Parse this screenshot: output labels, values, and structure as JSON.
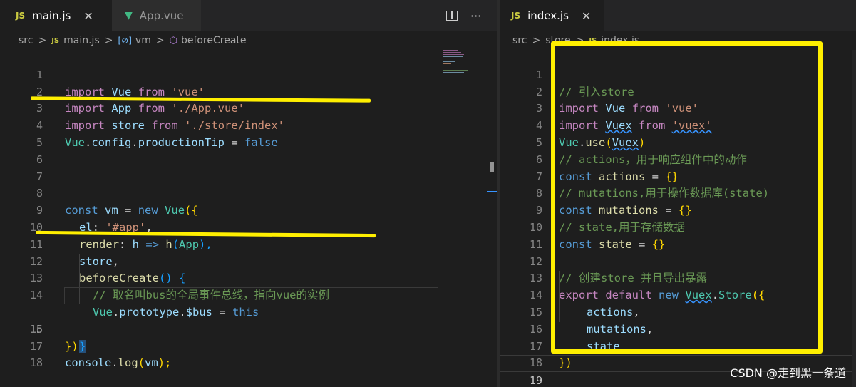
{
  "left_editor": {
    "tabs": [
      {
        "label": "main.js",
        "type_badge": "JS",
        "active": true,
        "close": "✕"
      },
      {
        "label": "App.vue",
        "active": false
      }
    ],
    "breadcrumb": {
      "folder": "src",
      "file": "main.js",
      "symbol1": "vm",
      "symbol2": "beforeCreate",
      "sep": ">"
    },
    "line_numbers": [
      "1",
      "2",
      "3",
      "4",
      "5",
      "6",
      "7",
      "8",
      "9",
      "10",
      "11",
      "12",
      "13",
      "14",
      "15",
      "16",
      "17",
      "18"
    ],
    "current_line": "15",
    "code": {
      "l1": {
        "kw_import": "import",
        "name": "Vue",
        "kw_from": "from",
        "src": "'vue'"
      },
      "l2": {
        "kw_import": "import",
        "name": "App",
        "kw_from": "from",
        "src": "'./App.vue'"
      },
      "l3": {
        "kw_import": "import",
        "name": "store",
        "kw_from": "from",
        "src": "'./store/index'"
      },
      "l4": {
        "obj": "Vue",
        "dot1": ".",
        "p1": "config",
        "dot2": ".",
        "p2": "productionTip",
        "eq": " = ",
        "val": "false"
      },
      "l8": {
        "kw": "const",
        "name": "vm",
        "eq": " = ",
        "kw_new": "new",
        "cls": "Vue",
        "open": "({"
      },
      "l9": {
        "key": "el",
        "colon": ": ",
        "val": "'#app'",
        "comma": ","
      },
      "l10": {
        "key": "render",
        "colon": ": ",
        "param": "h",
        "arrow": " => ",
        "fn": "h",
        "open": "(",
        "arg": "App",
        "close": "),"
      },
      "l11": {
        "name": "store",
        "comma": ","
      },
      "l12": {
        "fn": "beforeCreate",
        "parens": "()",
        "brace": " {"
      },
      "l13": {
        "comment": "// 取名叫bus的全局事件总线，指向vue的实例"
      },
      "l14": {
        "obj": "Vue",
        "dot1": ".",
        "p1": "prototype",
        "dot2": ".",
        "p2": "$bus",
        "eq": " = ",
        "val": "this"
      },
      "l15": {
        "brace": "}"
      },
      "l16": {
        "close": "})"
      },
      "l17": {
        "obj": "console",
        "dot": ".",
        "fn": "log",
        "open": "(",
        "arg": "vm",
        "close": ");"
      }
    }
  },
  "right_editor": {
    "tabs": [
      {
        "label": "index.js",
        "type_badge": "JS",
        "active": true,
        "close": "✕"
      }
    ],
    "breadcrumb": {
      "folder": "src",
      "folder2": "store",
      "file": "index.js",
      "sep": ">"
    },
    "line_numbers": [
      "1",
      "2",
      "3",
      "4",
      "5",
      "6",
      "7",
      "8",
      "9",
      "10",
      "11",
      "12",
      "13",
      "14",
      "15",
      "16",
      "17",
      "18",
      "19"
    ],
    "current_line": "19",
    "code": {
      "l1": {
        "comment": "// 引入store"
      },
      "l2": {
        "kw_import": "import",
        "name": "Vue",
        "kw_from": "from",
        "src": "'vue'"
      },
      "l3": {
        "kw_import": "import",
        "name": "Vuex",
        "kw_from": "from",
        "src": "'vuex'"
      },
      "l4": {
        "obj": "Vue",
        "dot": ".",
        "fn": "use",
        "open": "(",
        "arg": "Vuex",
        "close": ")"
      },
      "l5": {
        "comment": "// actions，用于响应组件中的动作"
      },
      "l6": {
        "kw": "const",
        "name": "actions",
        "eq": " = ",
        "val": "{}"
      },
      "l7": {
        "comment": "// mutations,用于操作数据库(state)"
      },
      "l8": {
        "kw": "const",
        "name": "mutations",
        "eq": " = ",
        "val": "{}"
      },
      "l9": {
        "comment": "// state,用于存储数据"
      },
      "l10": {
        "kw": "const",
        "name": "state",
        "eq": " = ",
        "val": "{}"
      },
      "l12": {
        "comment": "// 创建store 并且导出暴露"
      },
      "l13": {
        "kw_export": "export",
        "kw_default": "default",
        "kw_new": "new",
        "cls": "Vuex",
        "dot": ".",
        "fn": "Store",
        "open": "({"
      },
      "l14": {
        "name": "actions",
        "comma": ","
      },
      "l15": {
        "name": "mutations",
        "comma": ","
      },
      "l16": {
        "name": "state"
      },
      "l17": {
        "close": "})"
      }
    }
  },
  "watermark": "CSDN @走到黑一条道",
  "icons": {
    "split": "split-editor-icon",
    "more": "more-actions-icon",
    "vue": "vue-file-icon"
  },
  "colors": {
    "annotation": "#ffef00",
    "keyword": "#c586c0",
    "string": "#ce9178",
    "variable": "#9cdcfe"
  }
}
